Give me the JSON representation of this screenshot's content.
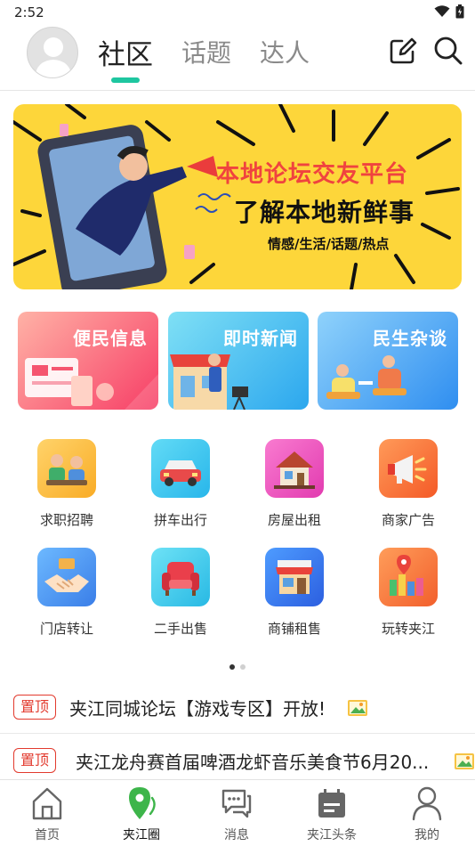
{
  "status_bar": {
    "time": "2:52",
    "icons": [
      "wifi-icon",
      "battery-icon"
    ]
  },
  "header": {
    "tabs": [
      {
        "label": "社区",
        "active": true
      },
      {
        "label": "话题",
        "active": false
      },
      {
        "label": "达人",
        "active": false
      }
    ],
    "icons": [
      "avatar",
      "edit-icon",
      "search-icon"
    ],
    "accent_color": "#1ec6a0"
  },
  "banner": {
    "title": "本地论坛交友平台",
    "subtitle": "了解本地新鲜事",
    "tags": "情感/生活/话题/热点"
  },
  "cards": [
    {
      "label": "便民信息",
      "color": "#f8516b"
    },
    {
      "label": "即时新闻",
      "color": "#3bb3f2"
    },
    {
      "label": "民生杂谈",
      "color": "#3d96f0"
    }
  ],
  "grid": [
    {
      "label": "求职招聘",
      "icon": "job-icon"
    },
    {
      "label": "拼车出行",
      "icon": "car-icon"
    },
    {
      "label": "房屋出租",
      "icon": "house-icon"
    },
    {
      "label": "商家广告",
      "icon": "megaphone-icon"
    },
    {
      "label": "门店转让",
      "icon": "handshake-icon"
    },
    {
      "label": "二手出售",
      "icon": "sofa-icon"
    },
    {
      "label": "商铺租售",
      "icon": "shop-icon"
    },
    {
      "label": "玩转夹江",
      "icon": "city-pin-icon"
    }
  ],
  "pinned": [
    {
      "badge": "置顶",
      "text": "夹江同城论坛【游戏专区】开放!"
    },
    {
      "badge": "置顶",
      "text": "夹江龙舟赛首届啤酒龙虾音乐美食节6月20..."
    }
  ],
  "bottom_nav": [
    {
      "label": "首页",
      "icon": "home-icon",
      "active": false
    },
    {
      "label": "夹江圈",
      "icon": "location-icon",
      "active": true
    },
    {
      "label": "消息",
      "icon": "message-icon",
      "active": false
    },
    {
      "label": "夹江头条",
      "icon": "news-icon",
      "active": false
    },
    {
      "label": "我的",
      "icon": "profile-icon",
      "active": false
    }
  ]
}
